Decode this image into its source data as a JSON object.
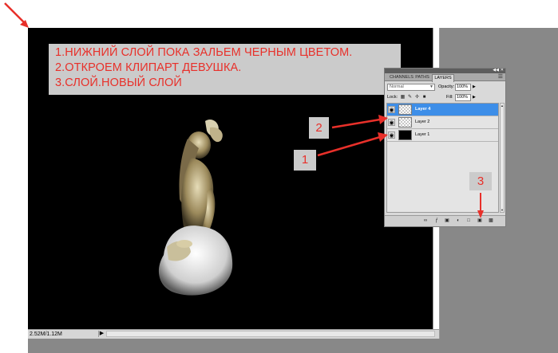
{
  "instructions": {
    "line1": "1.НИЖНИЙ СЛОЙ ПОКА ЗАЛЬЕМ ЧЕРНЫМ ЦВЕТОМ.",
    "line2": "2.ОТКРОЕМ КЛИПАРТ ДЕВУШКА.",
    "line3": "3.СЛОЙ.НОВЫЙ СЛОЙ"
  },
  "callouts": {
    "one": "1",
    "two": "2",
    "three": "3"
  },
  "status": {
    "doc_size": "2.52M/1.12M"
  },
  "layers_panel": {
    "tabs": {
      "channels": "CHANNELS",
      "paths": "PATHS",
      "layers": "LAYERS"
    },
    "blend_mode": "Normal",
    "opacity_label": "Opacity:",
    "opacity_value": "100%",
    "lock_label": "Lock:",
    "fill_label": "Fill:",
    "fill_value": "100%",
    "layers": [
      {
        "name": "Layer 4",
        "selected": true,
        "thumbnail": "transparent"
      },
      {
        "name": "Layer 2",
        "selected": false,
        "thumbnail": "clipart"
      },
      {
        "name": "Layer 1",
        "selected": false,
        "thumbnail": "black-fill"
      }
    ]
  },
  "colors": {
    "annotation_red": "#e8302a",
    "callout_gray": "#cbcbcb",
    "selected_layer": "#3d8ee8",
    "canvas": "#000000",
    "workspace_gray": "#888888"
  }
}
